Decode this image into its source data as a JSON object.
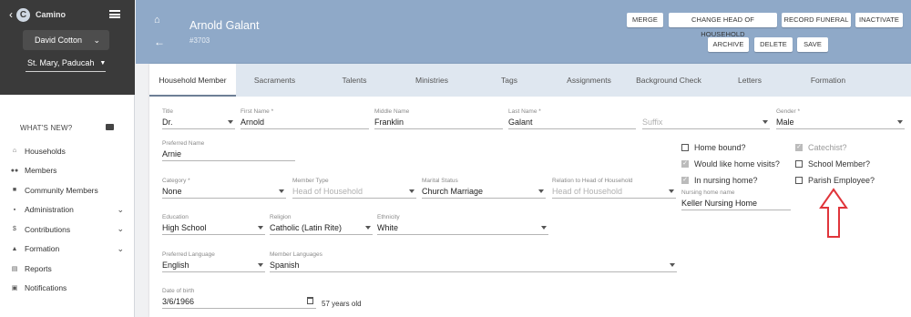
{
  "sidebar": {
    "brand": "Camino",
    "user": "David Cotton",
    "parish": "St. Mary, Paducah",
    "whats_new": "WHAT'S NEW?",
    "items": [
      {
        "label": "Households",
        "icon": "home-icon",
        "chevron": false
      },
      {
        "label": "Members",
        "icon": "people-icon",
        "chevron": false
      },
      {
        "label": "Community Members",
        "icon": "folder-icon",
        "chevron": false
      },
      {
        "label": "Administration",
        "icon": "lock-icon",
        "chevron": true
      },
      {
        "label": "Contributions",
        "icon": "dollar-icon",
        "chevron": true
      },
      {
        "label": "Formation",
        "icon": "graduation-cap-icon",
        "chevron": true
      },
      {
        "label": "Reports",
        "icon": "report-icon",
        "chevron": false
      },
      {
        "label": "Notifications",
        "icon": "bell-icon",
        "chevron": false
      }
    ]
  },
  "header": {
    "name": "Arnold Galant",
    "id": "#3703",
    "buttons": {
      "merge": "MERGE",
      "change_head": "CHANGE HEAD OF HOUSEHOLD",
      "record_funeral": "RECORD FUNERAL",
      "inactivate": "INACTIVATE",
      "archive": "ARCHIVE",
      "delete": "DELETE",
      "save": "SAVE"
    }
  },
  "tabs": [
    "Household Member",
    "Sacraments",
    "Talents",
    "Ministries",
    "Tags",
    "Assignments",
    "Background Check",
    "Letters",
    "Formation"
  ],
  "form": {
    "title": {
      "label": "Title",
      "value": "Dr."
    },
    "first_name": {
      "label": "First Name *",
      "value": "Arnold"
    },
    "middle_name": {
      "label": "Middle Name",
      "value": "Franklin"
    },
    "last_name": {
      "label": "Last Name *",
      "value": "Galant"
    },
    "suffix": {
      "placeholder": "Suffix"
    },
    "gender": {
      "label": "Gender *",
      "value": "Male"
    },
    "preferred_name": {
      "label": "Preferred Name",
      "value": "Arnie"
    },
    "category": {
      "label": "Category *",
      "value": "None"
    },
    "member_type": {
      "label": "Member Type",
      "value": "Head of Household"
    },
    "marital_status": {
      "label": "Marital Status",
      "value": "Church Marriage"
    },
    "relation": {
      "label": "Relation to Head of Household",
      "value": "Head of Household"
    },
    "education": {
      "label": "Education",
      "value": "High School"
    },
    "religion": {
      "label": "Religion",
      "value": "Catholic (Latin Rite)"
    },
    "ethnicity": {
      "label": "Ethnicity",
      "value": "White"
    },
    "preferred_language": {
      "label": "Preferred Language",
      "value": "English"
    },
    "member_languages": {
      "label": "Member Languages",
      "value": "Spanish"
    },
    "dob": {
      "label": "Date of birth",
      "value": "3/6/1966",
      "age": "57 years old"
    },
    "nursing_home_name": {
      "label": "Nursing home name",
      "value": "Keller Nursing Home"
    }
  },
  "checks": {
    "home_bound": {
      "label": "Home bound?",
      "checked": false
    },
    "home_visits": {
      "label": "Would like home visits?",
      "checked": true
    },
    "nursing_home": {
      "label": "In nursing home?",
      "checked": true
    },
    "catechist": {
      "label": "Catechist?",
      "checked": true,
      "disabled": true
    },
    "school_member": {
      "label": "School Member?",
      "checked": false
    },
    "parish_employee": {
      "label": "Parish Employee?",
      "checked": false
    }
  },
  "annotation": {
    "color": "#e0353b"
  },
  "colors": {
    "header": "#8fa9c8",
    "sidebar_top": "#3a3a3a",
    "tabs_bg": "#dfe7f0"
  }
}
